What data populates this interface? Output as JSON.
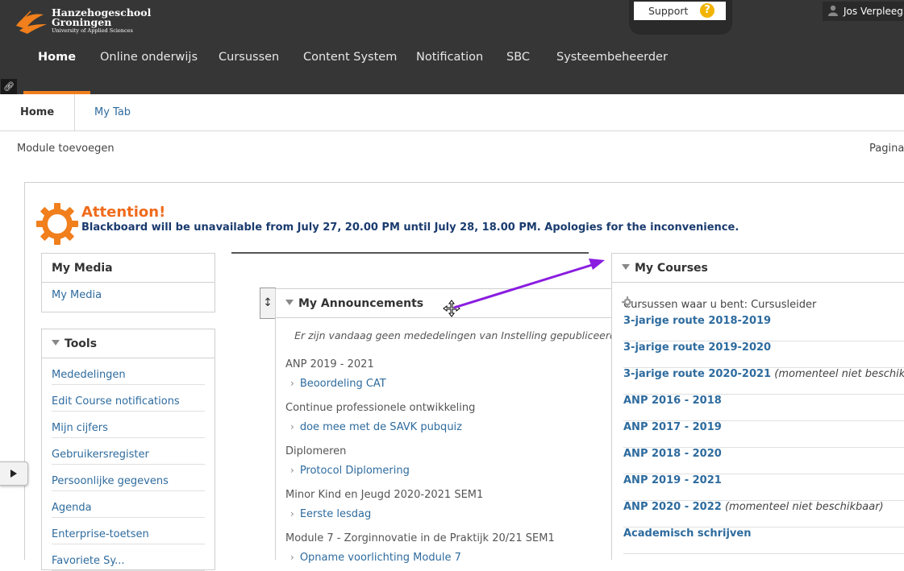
{
  "brand": {
    "line1": "Hanzehogeschool",
    "line2": "Groningen",
    "line3": "University of Applied Sciences"
  },
  "support": {
    "label": "Support",
    "help_glyph": "?"
  },
  "user": {
    "name": "Jos Verpleegk"
  },
  "nav": [
    "Home",
    "Online onderwijs",
    "Cursussen",
    "Content System",
    "Notification",
    "SBC",
    "Systeembeheerder"
  ],
  "tabs": {
    "home": "Home",
    "mytab": "My Tab"
  },
  "actions": {
    "add_module": "Module toevoegen",
    "page_label": "Pagina"
  },
  "attention": {
    "title": "Attention!",
    "message": "Blackboard will be unavailable from July 27, 20.00 PM until July 28, 18.00 PM. Apologies for the inconvenience."
  },
  "my_media": {
    "title": "My Media",
    "link": "My Media"
  },
  "tools": {
    "title": "Tools",
    "items": [
      "Mededelingen",
      "Edit Course notifications",
      "Mijn cijfers",
      "Gebruikersregister",
      "Persoonlijke gegevens",
      "Agenda",
      "Enterprise-toetsen",
      "Favoriete Sy..."
    ]
  },
  "announcements": {
    "title": "My Announcements",
    "none_message": "Er zijn vandaag geen mededelingen van Instelling gepubliceerd.",
    "groups": [
      {
        "course": "ANP 2019 - 2021",
        "item": "Beoordeling CAT"
      },
      {
        "course": "Continue professionele ontwikkeling",
        "item": "doe mee met de SAVK pubquiz"
      },
      {
        "course": "Diplomeren",
        "item": "Protocol Diplomering"
      },
      {
        "course": "Minor Kind en Jeugd 2020-2021 SEM1",
        "item": "Eerste lesdag"
      },
      {
        "course": "Module 7 - Zorginnovatie in de Praktijk 20/21 SEM1",
        "item": "Opname voorlichting Module 7"
      }
    ]
  },
  "courses": {
    "title": "My Courses",
    "subtitle": "Cursussen waar u bent: Cursusleider",
    "items": [
      {
        "name": "3-jarige route 2018-2019",
        "note": ""
      },
      {
        "name": "3-jarige route 2019-2020",
        "note": ""
      },
      {
        "name": "3-jarige route 2020-2021",
        "note": "(momenteel niet beschikbaar)"
      },
      {
        "name": "ANP 2016 - 2018",
        "note": ""
      },
      {
        "name": "ANP 2017 - 2019",
        "note": ""
      },
      {
        "name": "ANP 2018 - 2020",
        "note": ""
      },
      {
        "name": "ANP 2019 - 2021",
        "note": ""
      },
      {
        "name": "ANP 2020 - 2022",
        "note": "(momenteel niet beschikbaar)"
      },
      {
        "name": "Academisch schrijven",
        "note": ""
      }
    ]
  },
  "colors": {
    "accent": "#f07f1c",
    "header_bg": "#363636",
    "link": "#2e6b9e",
    "annotation_arrow": "#8a1de0"
  }
}
